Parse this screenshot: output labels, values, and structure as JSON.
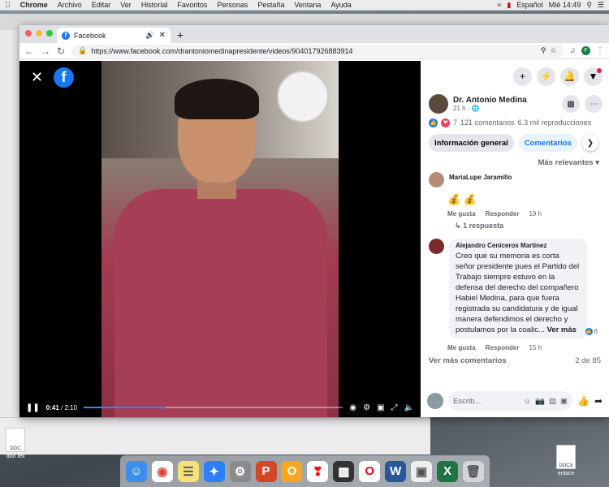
{
  "menubar": {
    "app": "Chrome",
    "items": [
      "Archivo",
      "Editar",
      "Ver",
      "Historial",
      "Favoritos",
      "Personas",
      "Pestaña",
      "Ventana",
      "Ayuda"
    ],
    "lang": "Español",
    "clock": "Mié 14:49"
  },
  "browser": {
    "tab_title": "Facebook",
    "url": "https://www.facebook.com/drantoniomedinapresidente/videos/904017926883914",
    "profile_letter": "F"
  },
  "video": {
    "current_time": "0:41",
    "duration": "2:10",
    "progress": 0.315
  },
  "post": {
    "author": "Dr. Antonio Medina",
    "time": "21 h",
    "reactions_count": "7",
    "comments_count": "121 comentarios",
    "views": "6.3 mil reproducciones"
  },
  "tabs": [
    "Información general",
    "Comentarios"
  ],
  "sort_label": "Más relevantes",
  "comments": [
    {
      "name": "MariaLupe Jaramillo",
      "emoji": "💰 💰",
      "like": "Me gusta",
      "reply": "Responder",
      "time": "19 h",
      "replies": "1 respuesta"
    },
    {
      "name": "Alejandro Ceniceros Martinez",
      "text": "Creo que su memoria es corta señor presidente pues el Partido del Trabajo siempre estuvo en la defensa del derecho del compañero Habiel Medina, para que fuera registrada su candidatura y de igual manera defendimos el derecho y postulamos por la coalic...",
      "more": "Ver más",
      "reactions": "6",
      "like": "Me gusta",
      "reply": "Responder",
      "time": "15 h"
    }
  ],
  "footer": {
    "view_more": "Ver más comentarios",
    "pager": "2 de 85"
  },
  "compose": {
    "placeholder": "Escrib..."
  },
  "desktop": {
    "left_file": "don feli",
    "left_file_ext": "DOC",
    "right_file": "enlace",
    "right_file_ext": "DOCX"
  },
  "colors": {
    "accent": "#1877f2",
    "video_bg": "#000000"
  }
}
